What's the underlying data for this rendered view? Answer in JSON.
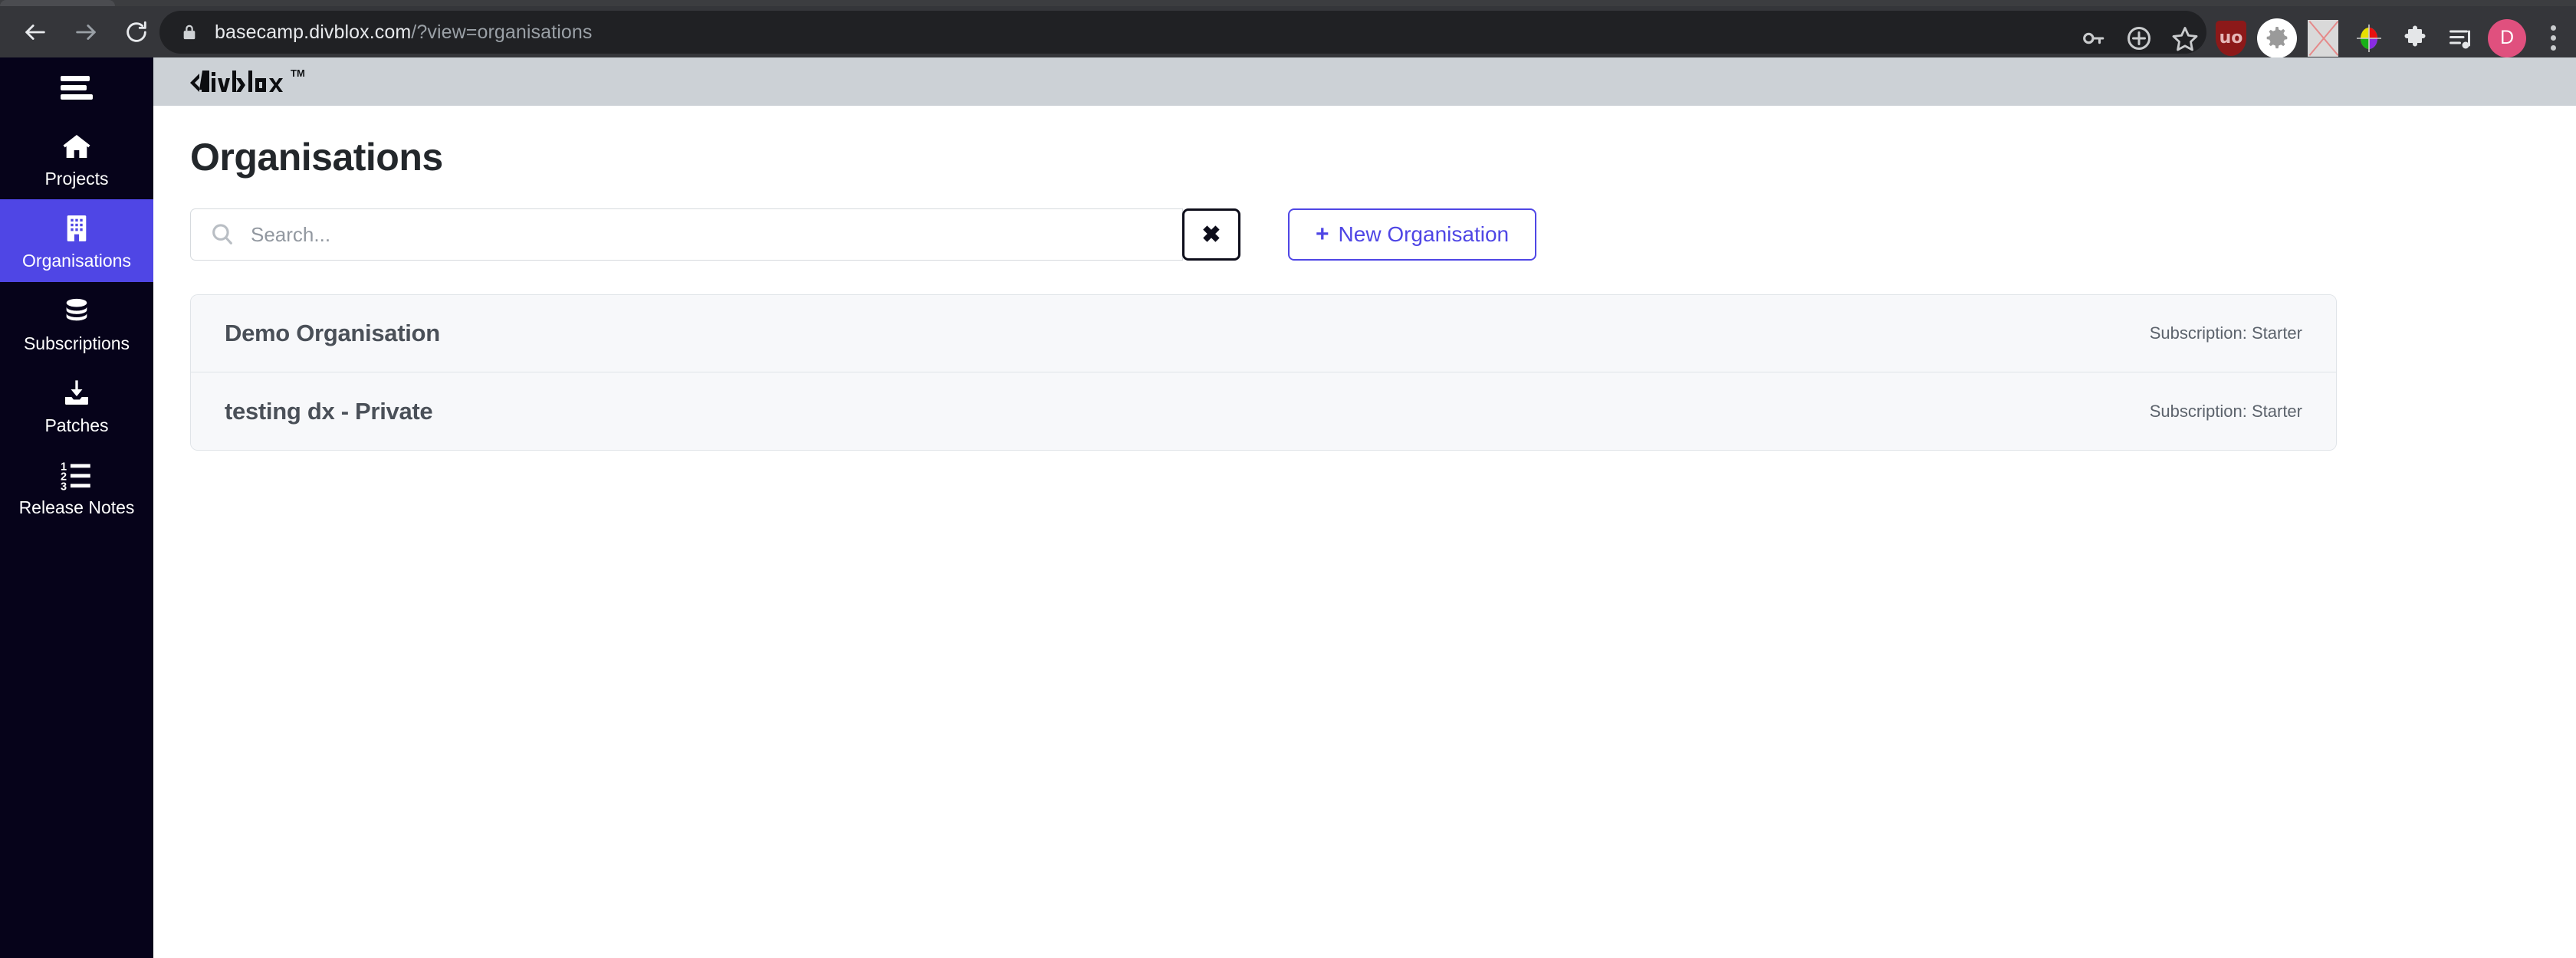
{
  "browser": {
    "back_label": "Back",
    "forward_label": "Forward",
    "reload_label": "Reload",
    "url_host": "basecamp.divblox.com",
    "url_path": "/?view=organisations",
    "lock_icon": "lock-icon",
    "toolbar_icons": [
      {
        "name": "password-key-icon",
        "glyph": "key"
      },
      {
        "name": "share-circle-icon",
        "glyph": "plus-circle"
      },
      {
        "name": "bookmark-star-icon",
        "glyph": "star"
      },
      {
        "name": "ublock-origin-extension-icon",
        "glyph": "uo"
      },
      {
        "name": "gear-extension-icon",
        "glyph": "gear"
      },
      {
        "name": "disabled-extension-icon",
        "glyph": "crossed-box"
      },
      {
        "name": "color-picker-extension-icon",
        "glyph": "color-wheel"
      },
      {
        "name": "extensions-puzzle-icon",
        "glyph": "puzzle"
      },
      {
        "name": "media-playlist-icon",
        "glyph": "playlist"
      }
    ],
    "profile_initial": "D",
    "menu_label": "Customize and control"
  },
  "sidebar": {
    "menu_toggle": "menu-toggle",
    "items": [
      {
        "label": "Projects",
        "icon": "home-icon",
        "active": false
      },
      {
        "label": "Organisations",
        "icon": "building-icon",
        "active": true
      },
      {
        "label": "Subscriptions",
        "icon": "database-icon",
        "active": false
      },
      {
        "label": "Patches",
        "icon": "download-inbox-icon",
        "active": false
      },
      {
        "label": "Release Notes",
        "icon": "numbered-list-icon",
        "active": false
      }
    ],
    "active_color": "#4f46e5",
    "background_color": "#06031a"
  },
  "app_header": {
    "logo_text": "divblox",
    "logo_tm": "TM",
    "background_color": "#ccd1d6"
  },
  "main": {
    "page_title": "Organisations",
    "search": {
      "placeholder": "Search...",
      "value": "",
      "icon": "search-icon",
      "clear_label": "✖"
    },
    "new_button": {
      "plus": "+",
      "label": "New Organisation",
      "accent_color": "#4f46e5"
    },
    "organisations": [
      {
        "name": "Demo Organisation",
        "subscription": "Subscription: Starter"
      },
      {
        "name": "testing dx - Private",
        "subscription": "Subscription: Starter"
      }
    ]
  }
}
